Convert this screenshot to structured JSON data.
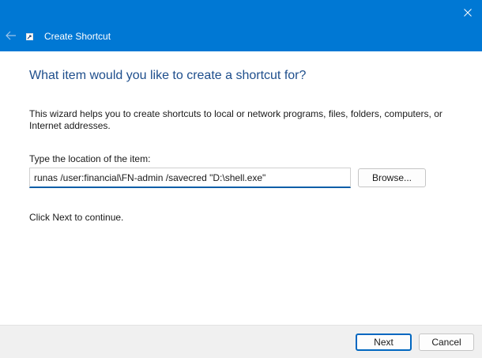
{
  "window": {
    "title": "Create Shortcut",
    "accent_color": "#0078d4",
    "heading_color": "#1e4e8c"
  },
  "titlebar": {
    "back_icon": "arrow-left-icon",
    "app_icon": "shortcut-icon",
    "close_icon": "close-icon"
  },
  "content": {
    "heading": "What item would you like to create a shortcut for?",
    "description": "This wizard helps you to create shortcuts to local or network programs, files, folders, computers, or Internet addresses.",
    "field_label": "Type the location of the item:",
    "location_value": "runas /user:financial\\FN-admin /savecred \"D:\\shell.exe\"",
    "browse_label": "Browse...",
    "continue_text": "Click Next to continue."
  },
  "footer": {
    "next_label": "Next",
    "cancel_label": "Cancel"
  }
}
